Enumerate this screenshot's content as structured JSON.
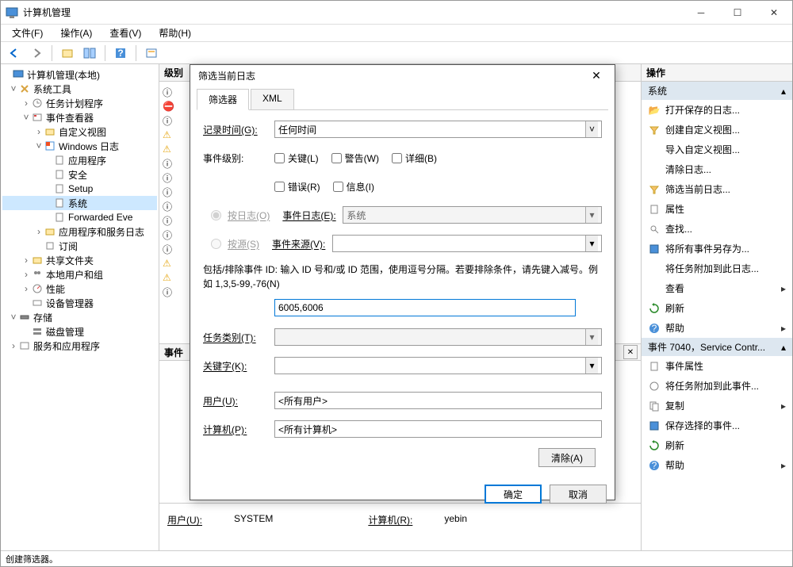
{
  "window": {
    "title": "计算机管理"
  },
  "menu": {
    "file": "文件(F)",
    "action": "操作(A)",
    "view": "查看(V)",
    "help": "帮助(H)"
  },
  "tree": {
    "root": "计算机管理(本地)",
    "systools": "系统工具",
    "tasksched": "任务计划程序",
    "eventviewer": "事件查看器",
    "customview": "自定义视图",
    "winlogs": "Windows 日志",
    "app": "应用程序",
    "security": "安全",
    "setup": "Setup",
    "system": "系统",
    "forwarded": "Forwarded Eve",
    "appsvc": "应用程序和服务日志",
    "subscription": "订阅",
    "shared": "共享文件夹",
    "localusers": "本地用户和组",
    "perf": "性能",
    "devmgr": "设备管理器",
    "storage": "存储",
    "diskmgr": "磁盘管理",
    "svcapps": "服务和应用程序"
  },
  "mid": {
    "level_col": "级别",
    "event_col": "事件"
  },
  "actions": {
    "header": "操作",
    "system": "系统",
    "open_saved": "打开保存的日志...",
    "create_custom": "创建自定义视图...",
    "import_custom": "导入自定义视图...",
    "clear_log": "清除日志...",
    "filter_current": "筛选当前日志...",
    "properties": "属性",
    "find": "查找...",
    "save_all": "将所有事件另存为...",
    "attach_task": "将任务附加到此日志...",
    "view": "查看",
    "refresh": "刷新",
    "help": "帮助",
    "event_7040": "事件 7040，Service Contr...",
    "event_props": "事件属性",
    "attach_task_event": "将任务附加到此事件...",
    "copy": "复制",
    "save_selected": "保存选择的事件...",
    "refresh2": "刷新",
    "help2": "帮助"
  },
  "dialog": {
    "title": "筛选当前日志",
    "tab_filter": "筛选器",
    "tab_xml": "XML",
    "record_time": "记录时间(G):",
    "record_time_val": "任何时间",
    "event_level": "事件级别:",
    "critical": "关键(L)",
    "warning": "警告(W)",
    "verbose": "详细(B)",
    "error": "错误(R)",
    "info": "信息(I)",
    "by_log": "按日志(O)",
    "by_source": "按源(S)",
    "event_log": "事件日志(E):",
    "event_log_val": "系统",
    "event_source": "事件来源(V):",
    "include_hint": "包括/排除事件 ID: 输入 ID 号和/或 ID 范围，使用逗号分隔。若要排除条件，请先键入减号。例如 1,3,5-99,-76(N)",
    "id_value": "6005,6006",
    "task_cat": "任务类别(T):",
    "keyword": "关键字(K):",
    "user": "用户(U):",
    "user_val": "<所有用户>",
    "computer": "计算机(P):",
    "computer_val": "<所有计算机>",
    "clear": "清除(A)",
    "ok": "确定",
    "cancel": "取消"
  },
  "detail": {
    "user_label": "用户(U):",
    "user_val": "SYSTEM",
    "computer_label": "计算机(R):",
    "computer_val": "yebin"
  },
  "status": "创建筛选器。"
}
